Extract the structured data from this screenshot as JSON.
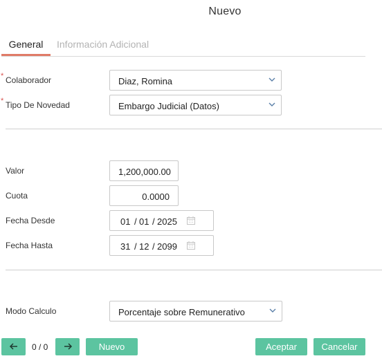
{
  "dialog": {
    "title": "Nuevo"
  },
  "tabs": [
    {
      "label": "General",
      "active": true
    },
    {
      "label": "Información Adicional",
      "active": false
    }
  ],
  "form": {
    "required_mark": "*",
    "colaborador": {
      "label": "Colaborador",
      "value": "Diaz, Romina"
    },
    "tipo_novedad": {
      "label": "Tipo De Novedad",
      "value": "Embargo Judicial (Datos)"
    },
    "valor": {
      "label": "Valor",
      "value": "1,200,000.00"
    },
    "cuota": {
      "label": "Cuota",
      "value": "0.0000"
    },
    "fecha_desde": {
      "label": "Fecha Desde",
      "day": "01",
      "month": "01",
      "year": "2025"
    },
    "fecha_hasta": {
      "label": "Fecha Hasta",
      "day": "31",
      "month": "12",
      "year": "2099"
    },
    "date_separator": "/",
    "modo_calculo": {
      "label": "Modo Calculo",
      "value": "Porcentaje sobre Remunerativo"
    }
  },
  "footer": {
    "pager": "0 / 0",
    "nuevo_label": "Nuevo",
    "aceptar_label": "Aceptar",
    "cancelar_label": "Cancelar"
  },
  "icons": {
    "prev": "arrow-left-icon",
    "next": "arrow-right-icon",
    "dropdown": "chevron-down-icon",
    "calendar": "calendar-icon"
  },
  "colors": {
    "accent_button": "#5cc4a0",
    "active_tab_underline": "#e07b67",
    "inactive_tab_text": "#b3b3b3",
    "required_mark": "#d9534f"
  }
}
